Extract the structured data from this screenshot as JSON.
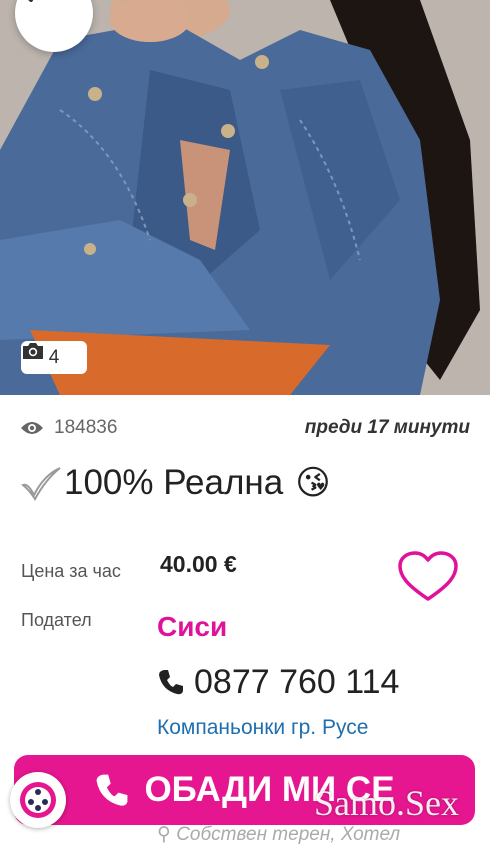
{
  "gallery": {
    "photo_count": "4"
  },
  "listing": {
    "views": "184836",
    "posted": "преди 17 минути",
    "title_text": "100% Реална",
    "title_emoji": "😘",
    "price_label": "Цена за час",
    "price": "40.00 €",
    "seller_label": "Подател",
    "seller_name": "Сиси",
    "phone": "0877 760 114",
    "category": "Компаньонки гр. Русе",
    "location": "Собствен терен, Хотел"
  },
  "actions": {
    "call_label": "ОБАДИ МИ СЕ"
  },
  "watermark": "Samo.Sex",
  "colors": {
    "accent": "#e5168f",
    "accent_text": "#e0119a",
    "link": "#1f6fb0"
  },
  "icons": {
    "back": "arrow-left-icon",
    "camera": "camera-icon",
    "eye": "eye-icon",
    "check": "check-mark-icon",
    "heart": "heart-outline-icon",
    "phone": "phone-icon",
    "location": "location-pin-icon",
    "float": "accessibility-icon"
  }
}
